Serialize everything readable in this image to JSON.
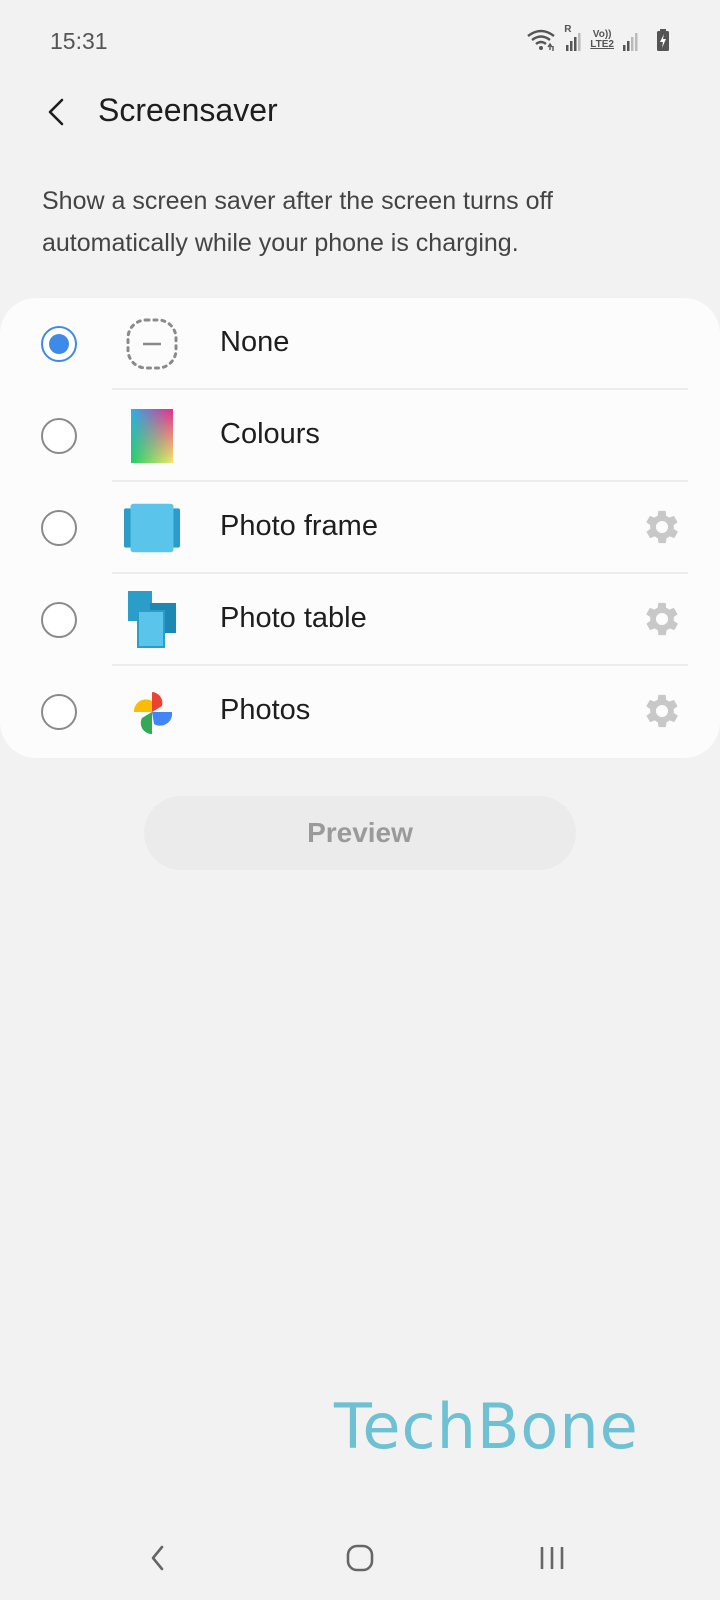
{
  "status_bar": {
    "time": "15:31",
    "icons": [
      "wifi-icon",
      "signal-roaming-icon",
      "volte-lte2-icon",
      "signal-icon",
      "battery-charging-icon"
    ],
    "roaming_label": "R",
    "volte_label": "Vo))",
    "lte_label": "LTE2"
  },
  "header": {
    "back_icon": "chevron-left-icon",
    "title": "Screensaver"
  },
  "description": "Show a screen saver after the screen turns off automatically while your phone is charging.",
  "options": [
    {
      "label": "None",
      "icon": "none-dashed-icon",
      "selected": true,
      "has_settings": false
    },
    {
      "label": "Colours",
      "icon": "colours-gradient-icon",
      "selected": false,
      "has_settings": false
    },
    {
      "label": "Photo frame",
      "icon": "photo-frame-icon",
      "selected": false,
      "has_settings": true
    },
    {
      "label": "Photo table",
      "icon": "photo-table-icon",
      "selected": false,
      "has_settings": true
    },
    {
      "label": "Photos",
      "icon": "google-photos-icon",
      "selected": false,
      "has_settings": true
    }
  ],
  "preview_button": {
    "label": "Preview",
    "enabled": false
  },
  "watermark": "TechBone",
  "navigation_bar": {
    "buttons": [
      "back-icon",
      "home-icon",
      "recents-icon"
    ]
  },
  "colors": {
    "accent": "#3e8ae8",
    "background": "#f2f2f2",
    "card": "#fcfcfc",
    "watermark": "#6ec1d2",
    "gear": "#c8c8c8"
  }
}
